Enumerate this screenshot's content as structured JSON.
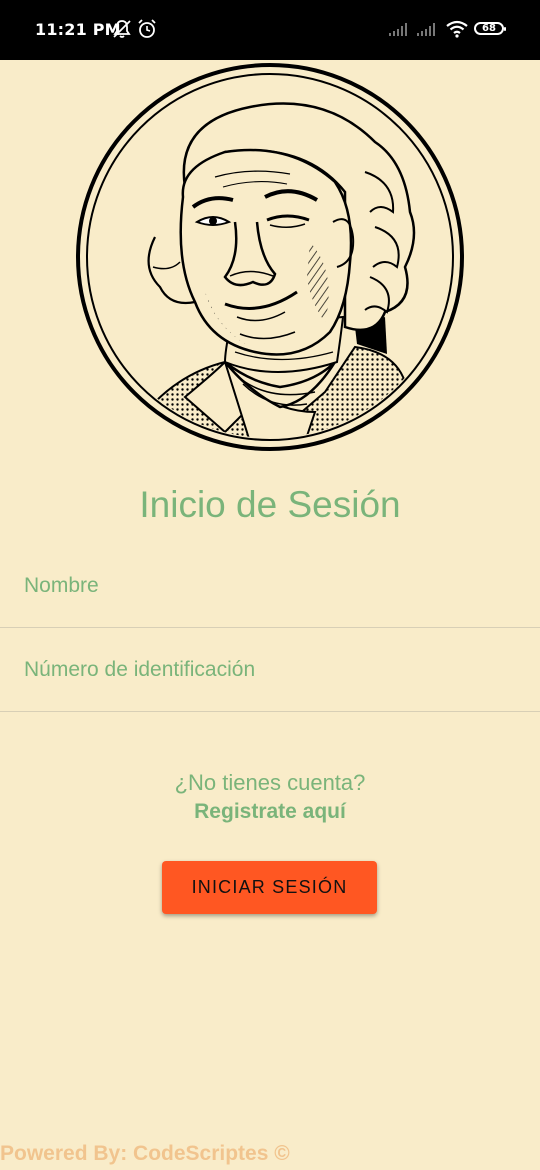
{
  "status_bar": {
    "time": "11:21 PM",
    "battery": "68"
  },
  "login": {
    "title": "Inicio de Sesión",
    "name_placeholder": "Nombre",
    "id_placeholder": "Número de identificación",
    "no_account_text": "¿No tienes cuenta?",
    "register_link": "Registrate aquí",
    "submit_label": "INICIAR SESIÓN"
  },
  "footer": {
    "powered_by": "Powered By: CodeScriptes ©"
  },
  "colors": {
    "background": "#f9ecc9",
    "accent_green": "#7ab47a",
    "button_orange": "#ff5722",
    "footer_text": "#f1c48e"
  },
  "images": {
    "logo": "coin-portrait-illustration"
  }
}
